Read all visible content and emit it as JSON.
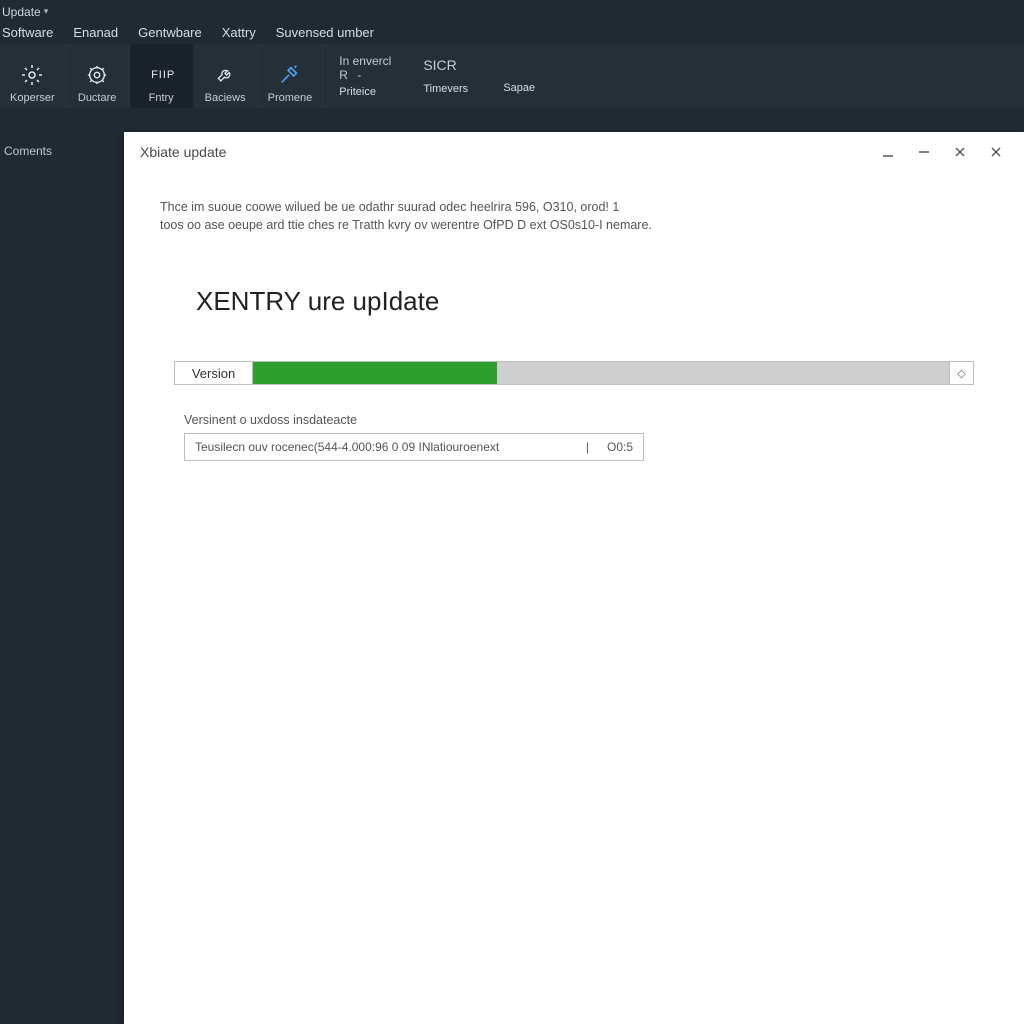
{
  "app": {
    "title": "Update",
    "menu": [
      "Software",
      "Enanad",
      "Gentwbare",
      "Xattry",
      "Suvensed umber"
    ]
  },
  "ribbon": {
    "items": [
      {
        "icon": "target",
        "label": "Koperser"
      },
      {
        "icon": "gear",
        "label": "Ductare"
      },
      {
        "icon": "monitor",
        "label": "Fntry",
        "top": "FIIP"
      },
      {
        "icon": "wrench",
        "label": "Baciews"
      },
      {
        "icon": "hammer",
        "label": "Promene"
      }
    ],
    "textcols": [
      {
        "line1": "In envercl",
        "line2": "R   -",
        "label": "Priteice"
      },
      {
        "line1": "",
        "line2": "SICR",
        "label": "Timevers"
      },
      {
        "line1": "",
        "line2": "",
        "label": "Sapae"
      }
    ]
  },
  "sidebar": {
    "label": "Coments"
  },
  "window": {
    "title": "Xbiate update",
    "message_line1": "Thce im suoue coowe wilued be ue odathr suurad odec heelrira 596, O310, orod! 1",
    "message_line2": "toos oo ase oeupe ard ttie ches re Tratth kvry ov werentre OfPD D ext OS0s10-I nemare.",
    "heading": "XENTRY ure upIdate",
    "progress": {
      "label": "Version",
      "percent": 35,
      "endcap": "◇"
    },
    "details": {
      "subheading": "Versinent o uxdoss insdateacte",
      "left": "Teusilecn ouv rocenec(544-4.000:96 0 09 INlatiouroenext",
      "sep": "|",
      "right": "O0:5"
    }
  }
}
